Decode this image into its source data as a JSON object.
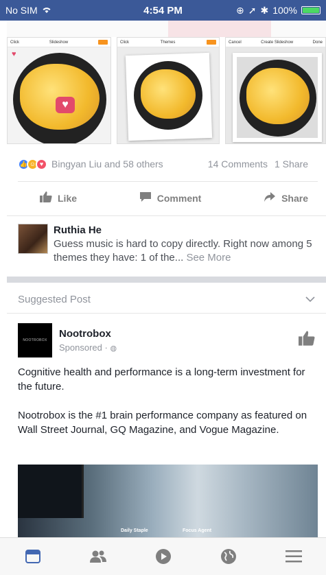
{
  "status_bar": {
    "carrier": "No SIM",
    "time": "4:54 PM",
    "battery": "100%"
  },
  "photos": [
    {
      "bar_left": "Click",
      "bar_center": "Slideshow"
    },
    {
      "bar_left": "Click",
      "bar_center": "Themes"
    },
    {
      "bar_left": "Cancel",
      "bar_center": "Create Slideshow",
      "bar_right": "Done"
    }
  ],
  "reactions": {
    "names": "Bingyan Liu and 58 others",
    "comments": "14 Comments",
    "shares": "1 Share"
  },
  "actions": {
    "like": "Like",
    "comment": "Comment",
    "share": "Share"
  },
  "comment_preview": {
    "name": "Ruthia He",
    "text": "Guess music is hard to copy directly. Right now among 5 themes they have: 1 of the...",
    "see_more": "See More"
  },
  "suggested": {
    "label": "Suggested Post"
  },
  "sponsor": {
    "name": "Nootrobox",
    "sub": "Sponsored · ",
    "logo_text": "NOOTROBOX"
  },
  "post": {
    "paragraph1": "Cognitive health and performance is a long-term investment for the future.",
    "paragraph2": "Nootrobox is the #1 brain performance company as featured on Wall Street Journal, GQ Magazine, and Vogue Magazine."
  },
  "ad": {
    "caption1": "Daily Staple",
    "caption2": "Focus Agent"
  },
  "colors": {
    "brand": "#3b5998",
    "active_tab": "#4267b2"
  }
}
